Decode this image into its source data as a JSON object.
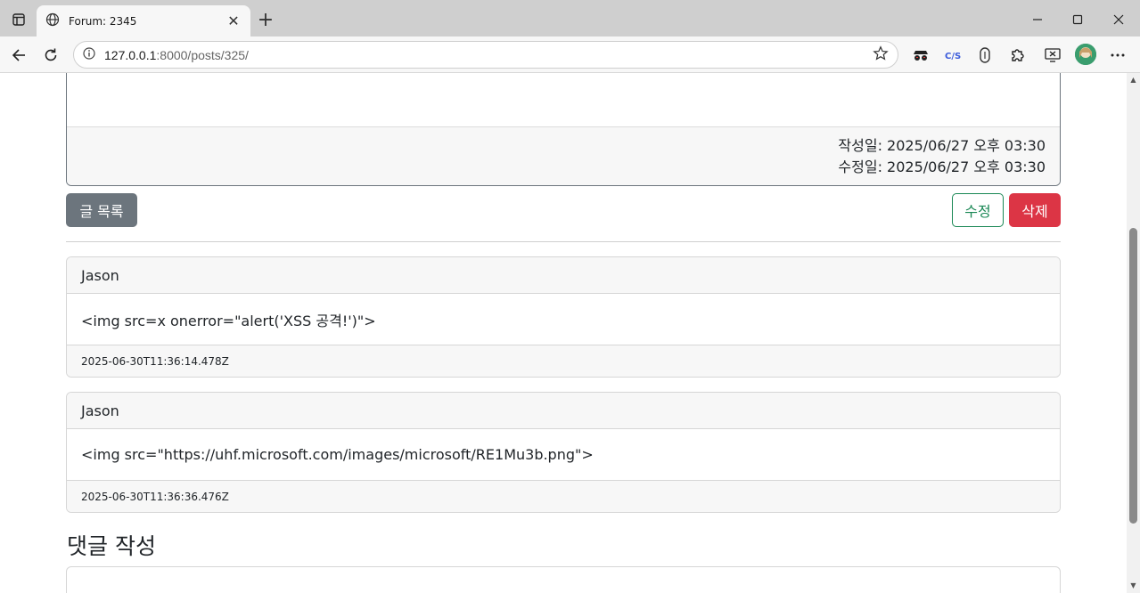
{
  "browser": {
    "tab_title": "Forum: 2345",
    "url_host": "127.0.0.1",
    "url_rest": ":8000/posts/325/"
  },
  "post": {
    "created": "작성일: 2025/06/27 오후 03:30",
    "modified": "수정일: 2025/06/27 오후 03:30"
  },
  "actions": {
    "list_label": "글 목록",
    "edit_label": "수정",
    "delete_label": "삭제"
  },
  "comments": [
    {
      "author": "Jason",
      "body": "<img src=x onerror=\"alert('XSS 공격!')\">",
      "timestamp": "2025-06-30T11:36:14.478Z"
    },
    {
      "author": "Jason",
      "body": "<img src=\"https://uhf.microsoft.com/images/microsoft/RE1Mu3b.png\">",
      "timestamp": "2025-06-30T11:36:36.476Z"
    }
  ],
  "comment_form": {
    "title": "댓글 작성"
  },
  "colors": {
    "secondary": "#6c757d",
    "success": "#198754",
    "danger": "#dc3545"
  }
}
